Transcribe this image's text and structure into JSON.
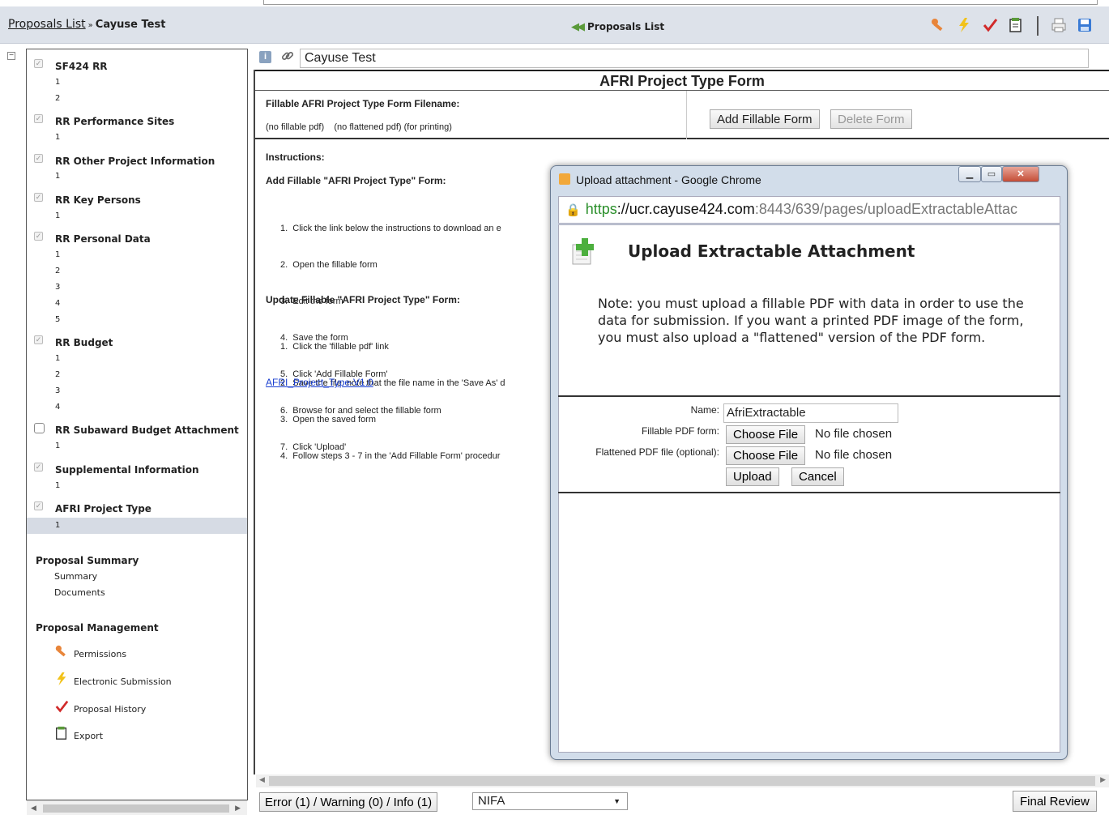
{
  "header": {
    "breadcrumb_link": "Proposals List",
    "breadcrumb_sep": "»",
    "breadcrumb_current": "Cayuse Test",
    "center_link": "Proposals List"
  },
  "sidebar": {
    "forms": [
      {
        "label": "SF424 RR",
        "checked": true,
        "items": [
          "1",
          "2"
        ]
      },
      {
        "label": "RR Performance Sites",
        "checked": true,
        "items": [
          "1"
        ]
      },
      {
        "label": "RR Other Project Information",
        "checked": true,
        "items": [
          "1"
        ]
      },
      {
        "label": "RR Key Persons",
        "checked": true,
        "items": [
          "1"
        ]
      },
      {
        "label": "RR Personal Data",
        "checked": true,
        "items": [
          "1",
          "2",
          "3",
          "4",
          "5"
        ]
      },
      {
        "label": "RR Budget",
        "checked": true,
        "items": [
          "1",
          "2",
          "3",
          "4"
        ]
      },
      {
        "label": "RR Subaward Budget Attachment",
        "checked": false,
        "items": [
          "1"
        ]
      },
      {
        "label": "Supplemental Information",
        "checked": true,
        "items": [
          "1"
        ]
      },
      {
        "label": "AFRI Project Type",
        "checked": true,
        "items": [
          "1"
        ]
      }
    ],
    "summary_title": "Proposal Summary",
    "summary_links": [
      "Summary",
      "Documents"
    ],
    "management_title": "Proposal Management",
    "management_links": [
      "Permissions",
      "Electronic Submission",
      "Proposal History",
      "Export"
    ]
  },
  "main": {
    "proposal_title": "Cayuse Test",
    "form_title": "AFRI Project Type Form",
    "filename_label": "Fillable AFRI Project Type Form Filename:",
    "filename_status": "(no fillable pdf)    (no flattened pdf) (for printing)",
    "add_button": "Add Fillable Form",
    "delete_button": "Delete Form",
    "instructions_label": "Instructions:",
    "add_heading": "Add Fillable \"AFRI Project Type\" Form:",
    "add_steps": [
      "1.  Click the link below the instructions to download an e",
      "2.  Open the fillable form",
      "3.  Edit the form",
      "4.  Save the form",
      "5.  Click 'Add Fillable Form'",
      "6.  Browse for and select the fillable form",
      "7.  Click 'Upload'"
    ],
    "update_heading": "Update Fillable \"AFRI Project Type\" Form:",
    "update_steps": [
      "1.  Click the 'fillable pdf' link",
      "2.  Save the file: note that the file name in the 'Save As' d",
      "3.  Open the saved form",
      "4.  Follow steps 3 - 7 in the 'Add Fillable Form' procedur"
    ],
    "pdf_link": "AFRI_Project_Type-V1.0"
  },
  "status_bar": {
    "messages": "Error (1) / Warning (0) / Info (1)",
    "agency": "NIFA",
    "final_review": "Final Review"
  },
  "dialog": {
    "window_title": "Upload attachment - Google Chrome",
    "url_scheme": "https",
    "url_host": "://ucr.cayuse424.com",
    "url_rest": ":8443/639/pages/uploadExtractableAttac",
    "heading": "Upload Extractable Attachment",
    "note": "Note: you must upload a fillable PDF with data in order to use the data for submission. If you want a printed PDF image of the form, you must also upload a \"flattened\" version of the PDF form.",
    "name_label": "Name:",
    "name_value": "AfriExtractable",
    "fillable_label": "Fillable PDF form:",
    "flattened_label": "Flattened PDF file (optional):",
    "choose_file": "Choose File",
    "no_file": "No file chosen",
    "upload": "Upload",
    "cancel": "Cancel"
  },
  "colors": {
    "header_bg": "#dde2ea",
    "selected_row": "#d6dbe4",
    "link_blue": "#1a3fd0",
    "secure_green": "#2a8f2a",
    "dialog_frame": "#d2ddea"
  }
}
